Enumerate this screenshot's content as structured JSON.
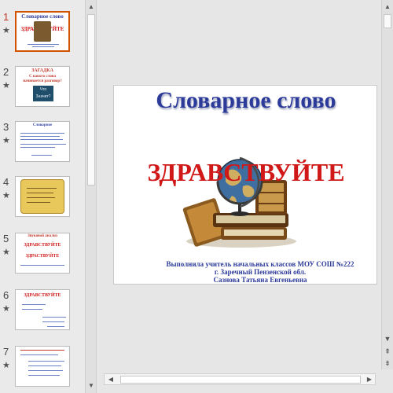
{
  "thumbnails": [
    {
      "number": "1",
      "title_line1": "Словарное слово",
      "title_line2": "ЗДРАВСТВУЙТЕ",
      "active": true
    },
    {
      "number": "2",
      "title_line1": "ЗАГАДКА",
      "title_line2": "С какого слова",
      "title_line3": "начинается разговор?",
      "badge": "Что Значит?",
      "active": false
    },
    {
      "number": "3",
      "title_line1": "Словарное",
      "active": false
    },
    {
      "number": "4",
      "active": false
    },
    {
      "number": "5",
      "title_line1": "Звуковой анализ",
      "title_line2": "ЗДРАВСТВУЙТЕ",
      "title_line3": "ЗДРАСТВУЙТЕ",
      "active": false
    },
    {
      "number": "6",
      "title_line1": "ЗДРАВСТВУЙТЕ",
      "active": false
    },
    {
      "number": "7",
      "active": false
    }
  ],
  "slide": {
    "title": "Словарное слово",
    "word": "ЗДРАВСТВУЙТЕ",
    "author_line1": "Выполнила учитель начальных классов МОУ СОШ №222",
    "author_line2": "г. Заречный Пензенской обл.",
    "author_line3": "Сазнова Татьяна Евгеньевна"
  },
  "icons": {
    "star": "★",
    "up": "▲",
    "down": "▼",
    "left": "◀",
    "right": "▶",
    "prev_slide": "⇞",
    "next_slide": "⇟"
  }
}
